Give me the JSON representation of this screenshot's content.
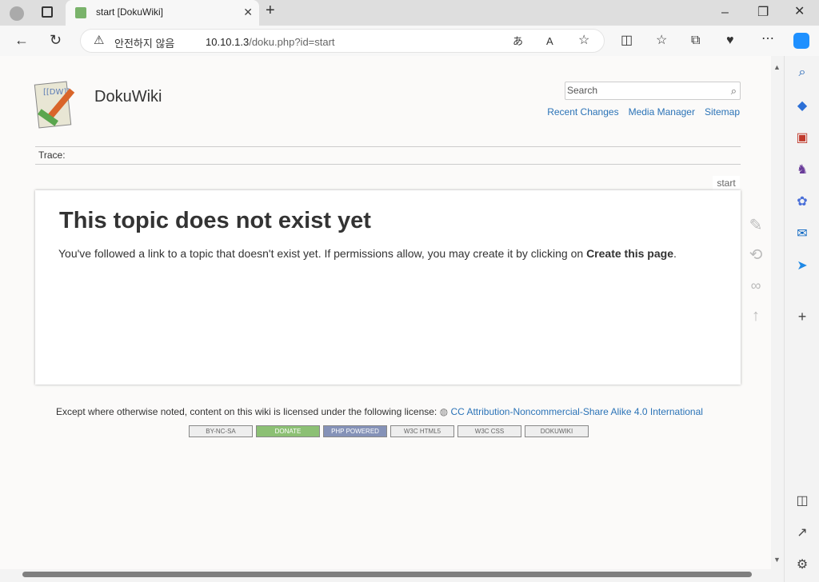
{
  "browser": {
    "tab_title": "start [DokuWiki]",
    "security_label": "안전하지 않음",
    "url_host": "10.10.1.3",
    "url_path": "/doku.php?id=start",
    "close_glyph": "✕",
    "newtab_glyph": "+"
  },
  "wiki": {
    "title": "DokuWiki",
    "search_placeholder": "Search",
    "tools": [
      "Recent Changes",
      "Media Manager",
      "Sitemap"
    ],
    "trace_label": "Trace:",
    "page_id": "start"
  },
  "page": {
    "heading": "This topic does not exist yet",
    "msg_before": "You've followed a link to a topic that doesn't exist yet. If permissions allow, you may create it by clicking on ",
    "msg_bold": "Create this page",
    "msg_after": "."
  },
  "footer": {
    "text": "Except where otherwise noted, content on this wiki is licensed under the following license:",
    "license": "CC Attribution-Noncommercial-Share Alike 4.0 International",
    "badges": [
      "BY-NC-SA",
      "DONATE",
      "PHP POWERED",
      "W3C HTML5",
      "W3C CSS",
      "DOKUWIKI"
    ]
  }
}
